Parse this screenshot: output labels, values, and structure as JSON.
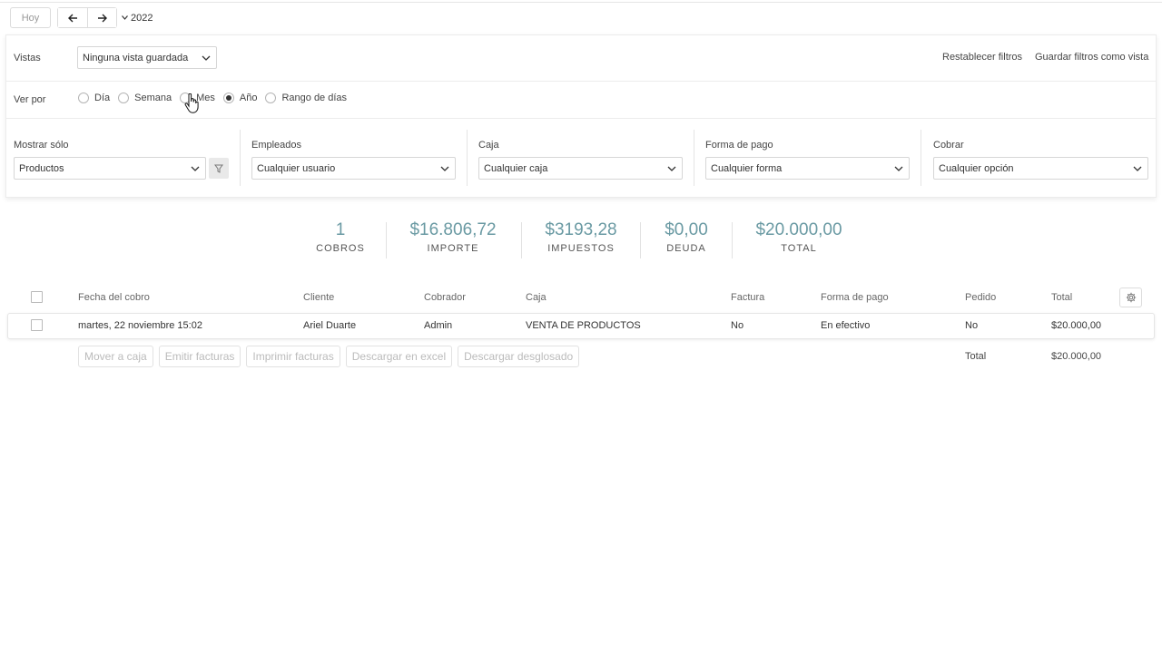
{
  "nav": {
    "today_label": "Hoy",
    "year": "2022"
  },
  "filters": {
    "views_label": "Vistas",
    "views_value": "Ninguna vista guardada",
    "reset_label": "Restablecer filtros",
    "save_label": "Guardar filtros como vista",
    "view_by_label": "Ver por",
    "view_by_options": [
      {
        "label": "Día",
        "selected": false
      },
      {
        "label": "Semana",
        "selected": false
      },
      {
        "label": "Mes",
        "selected": false
      },
      {
        "label": "Año",
        "selected": true
      },
      {
        "label": "Rango de días",
        "selected": false
      }
    ],
    "groups": [
      {
        "label": "Mostrar sólo",
        "value": "Productos"
      },
      {
        "label": "Empleados",
        "value": "Cualquier usuario"
      },
      {
        "label": "Caja",
        "value": "Cualquier caja"
      },
      {
        "label": "Forma de pago",
        "value": "Cualquier forma"
      },
      {
        "label": "Cobrar",
        "value": "Cualquier opción"
      }
    ]
  },
  "stats": [
    {
      "value": "1",
      "caption": "COBROS"
    },
    {
      "value": "$16.806,72",
      "caption": "IMPORTE"
    },
    {
      "value": "$3193,28",
      "caption": "IMPUESTOS"
    },
    {
      "value": "$0,00",
      "caption": "DEUDA"
    },
    {
      "value": "$20.000,00",
      "caption": "TOTAL"
    }
  ],
  "table": {
    "columns": [
      "Fecha del cobro",
      "Cliente",
      "Cobrador",
      "Caja",
      "Factura",
      "Forma de pago",
      "Pedido",
      "Total"
    ],
    "rows": [
      [
        "martes, 22 noviembre 15:02",
        "Ariel Duarte",
        "Admin",
        "VENTA DE PRODUCTOS",
        "No",
        "En efectivo",
        "No",
        "$20.000,00"
      ]
    ],
    "actions": [
      "Mover a caja",
      "Emitir facturas",
      "Imprimir facturas",
      "Descargar en excel",
      "Descargar desglosado"
    ],
    "footer_label": "Total",
    "footer_total": "$20.000,00"
  },
  "colors": {
    "stat_value": "#6a9aa3",
    "disabled_text": "#bbbbbb"
  }
}
